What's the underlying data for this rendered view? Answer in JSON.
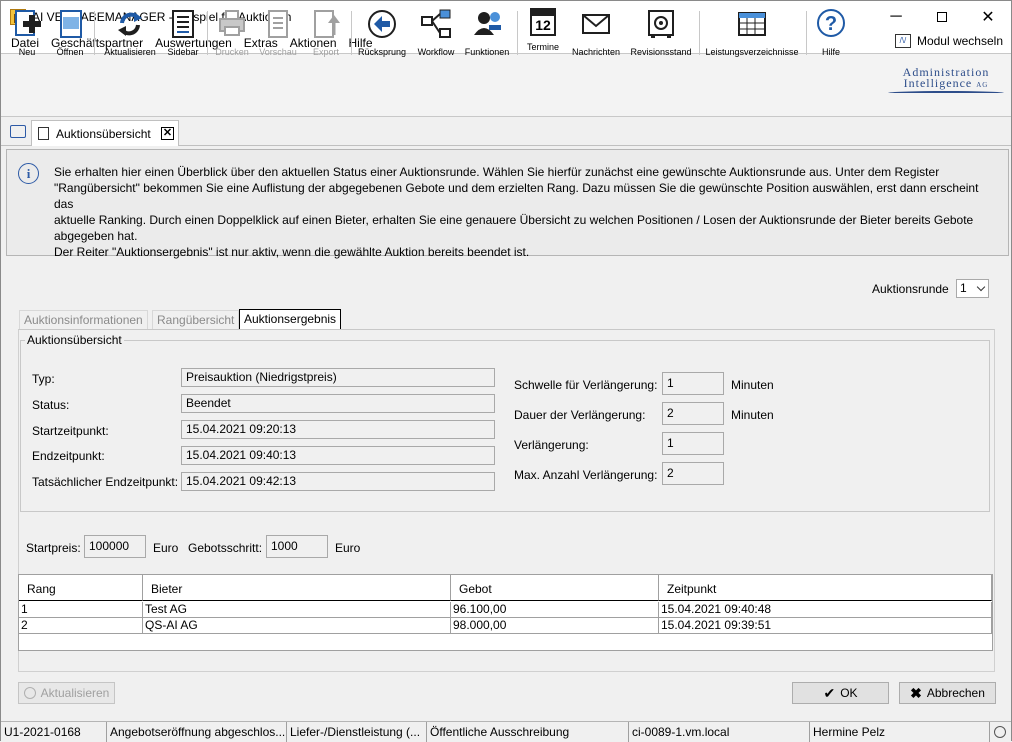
{
  "window": {
    "title": "AI VERGABEMANAGER - Beispiel für Auktionen"
  },
  "menu": {
    "items": [
      "Datei",
      "Geschäftspartner",
      "Auswertungen",
      "Extras",
      "Aktionen",
      "Hilfe"
    ],
    "modul": "Modul wechseln"
  },
  "toolbar": {
    "buttons": [
      {
        "label": "Neu",
        "icon": "new-doc-icon",
        "enabled": true
      },
      {
        "label": "Öffnen",
        "icon": "open-doc-icon",
        "enabled": true
      },
      {
        "label": "Aktualisieren",
        "icon": "refresh-icon",
        "enabled": true
      },
      {
        "label": "Sidebar",
        "icon": "sidebar-icon",
        "enabled": true
      },
      {
        "label": "Drucken",
        "icon": "printer-icon",
        "enabled": false
      },
      {
        "label": "Vorschau",
        "icon": "preview-icon",
        "enabled": false
      },
      {
        "label": "Export",
        "icon": "export-icon",
        "enabled": false
      },
      {
        "label": "Rücksprung",
        "icon": "back-arrow-icon",
        "enabled": true
      },
      {
        "label": "Workflow",
        "icon": "workflow-icon",
        "enabled": true
      },
      {
        "label": "Funktionen",
        "icon": "functions-icon",
        "enabled": true
      },
      {
        "label": "Termine",
        "icon": "calendar-icon",
        "enabled": true
      },
      {
        "label": "Nachrichten",
        "icon": "envelope-icon",
        "enabled": true
      },
      {
        "label": "Revisionsstand",
        "icon": "safe-icon",
        "enabled": true
      },
      {
        "label": "Leistungsverzeichnisse",
        "icon": "table-icon",
        "enabled": true
      },
      {
        "label": "Hilfe",
        "icon": "help-icon",
        "enabled": true
      }
    ],
    "calendar_day": "12",
    "logo_line1": "Administration",
    "logo_line2": "Intelligence",
    "logo_suffix": "AG"
  },
  "doc_tab": {
    "label": "Auktionsübersicht"
  },
  "info": {
    "text_lines": [
      "Sie erhalten hier einen Überblick über den aktuellen Status einer Auktionsrunde. Wählen Sie hierfür zunächst eine gewünschte Auktionsrunde aus. Unter dem Register",
      "\"Rangübersicht\" bekommen Sie eine Auflistung der abgegebenen Gebote und dem erzielten Rang. Dazu müssen Sie die gewünschte Position auswählen, erst dann erscheint das",
      "aktuelle Ranking. Durch einen Doppelklick auf einen Bieter, erhalten Sie eine genauere Übersicht zu welchen Positionen / Losen der Auktionsrunde der Bieter bereits Gebote",
      "abgegeben hat.",
      "Der Reiter \"Auktionsergebnis\" ist nur aktiv, wenn die gewählte Auktion bereits beendet ist."
    ]
  },
  "auktionsrunde": {
    "label": "Auktionsrunde",
    "value": "1"
  },
  "tabs": [
    {
      "label": "Auktionsinformationen",
      "active": false
    },
    {
      "label": "Rangübersicht",
      "active": false
    },
    {
      "label": "Auktionsergebnis",
      "active": true
    }
  ],
  "group": {
    "title": "Auktionsübersicht",
    "left": [
      {
        "label": "Typ:",
        "value": "Preisauktion (Niedrigstpreis)"
      },
      {
        "label": "Status:",
        "value": "Beendet"
      },
      {
        "label": "Startzeitpunkt:",
        "value": "15.04.2021 09:20:13"
      },
      {
        "label": "Endzeitpunkt:",
        "value": "15.04.2021 09:40:13"
      },
      {
        "label": "Tatsächlicher Endzeitpunkt:",
        "value": "15.04.2021 09:42:13"
      }
    ],
    "right": [
      {
        "label": "Schwelle für Verlängerung:",
        "value": "1",
        "unit": "Minuten"
      },
      {
        "label": "Dauer der Verlängerung:",
        "value": "2",
        "unit": "Minuten"
      },
      {
        "label": "Verlängerung:",
        "value": "1",
        "unit": ""
      },
      {
        "label": "Max. Anzahl Verlängerung:",
        "value": "2",
        "unit": ""
      }
    ]
  },
  "price": {
    "start_label": "Startpreis:",
    "start_value": "100000",
    "start_unit": "Euro",
    "step_label": "Gebotsschritt:",
    "step_value": "1000",
    "step_unit": "Euro"
  },
  "table": {
    "headers": [
      "Rang",
      "Bieter",
      "Gebot",
      "Zeitpunkt"
    ],
    "rows": [
      [
        "1",
        "Test AG",
        "96.100,00",
        "15.04.2021 09:40:48"
      ],
      [
        "2",
        "QS-AI AG",
        "98.000,00",
        "15.04.2021 09:39:51"
      ]
    ]
  },
  "buttons": {
    "refresh": "Aktualisieren",
    "ok": "OK",
    "cancel": "Abbrechen"
  },
  "statusbar": [
    "U1-2021-0168",
    "Angebotseröffnung abgeschlos...",
    "Liefer-/Dienstleistung (...",
    "Öffentliche Ausschreibung",
    "ci-0089-1.vm.local",
    "Hermine Pelz"
  ]
}
